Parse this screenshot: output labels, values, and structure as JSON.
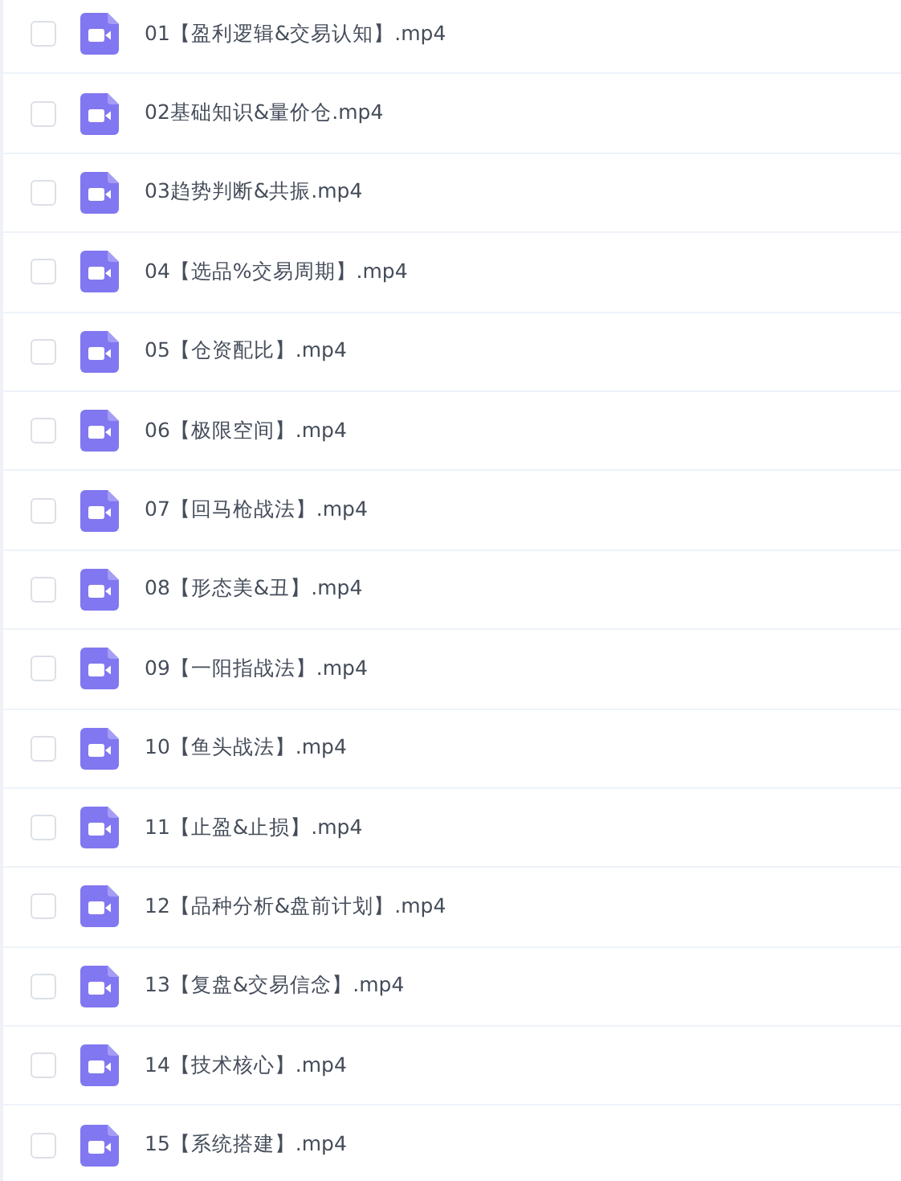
{
  "files": [
    {
      "name": "01【盈利逻辑&交易认知】.mp4",
      "checked": false
    },
    {
      "name": "02基础知识&量价仓.mp4",
      "checked": false
    },
    {
      "name": "03趋势判断&共振.mp4",
      "checked": false
    },
    {
      "name": "04【选品%交易周期】.mp4",
      "checked": false
    },
    {
      "name": "05【仓资配比】.mp4",
      "checked": false
    },
    {
      "name": "06【极限空间】.mp4",
      "checked": false
    },
    {
      "name": "07【回马枪战法】.mp4",
      "checked": false
    },
    {
      "name": "08【形态美&丑】.mp4",
      "checked": false
    },
    {
      "name": "09【一阳指战法】.mp4",
      "checked": false
    },
    {
      "name": "10【鱼头战法】.mp4",
      "checked": false
    },
    {
      "name": "11【止盈&止损】.mp4",
      "checked": false
    },
    {
      "name": "12【品种分析&盘前计划】.mp4",
      "checked": false
    },
    {
      "name": "13【复盘&交易信念】.mp4",
      "checked": false
    },
    {
      "name": "14【技术核心】.mp4",
      "checked": false
    },
    {
      "name": "15【系统搭建】.mp4",
      "checked": false
    }
  ]
}
